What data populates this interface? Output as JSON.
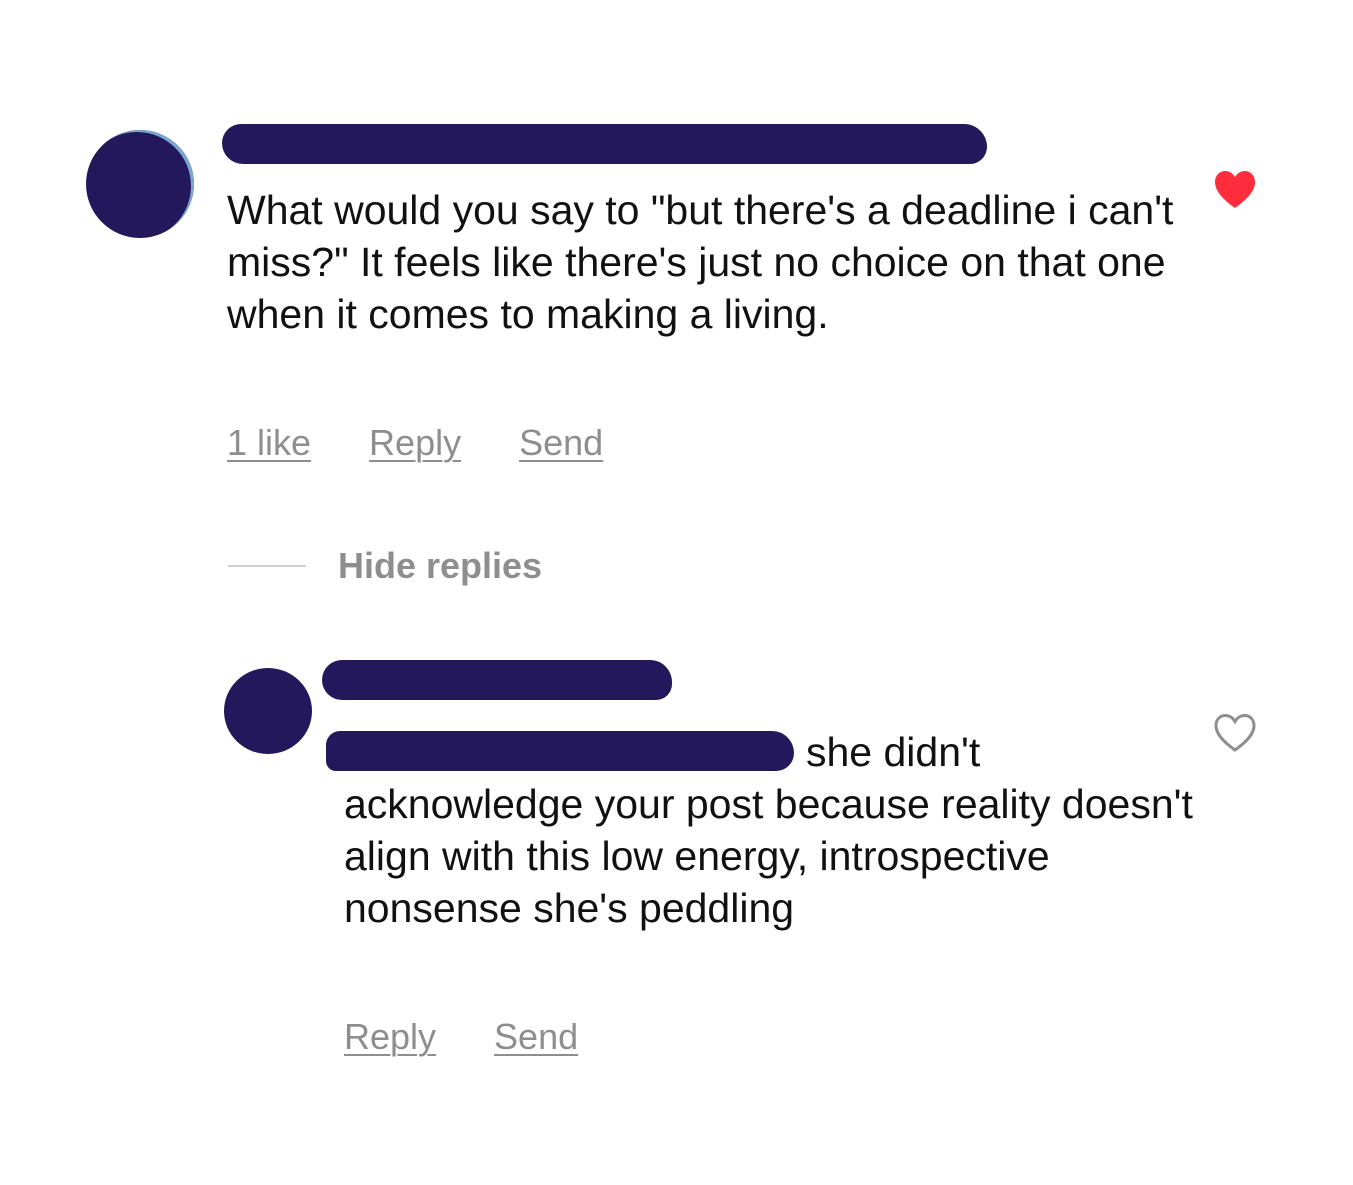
{
  "comment": {
    "text": "What would you say to \"but there's a deadline i can't miss?\" It feels like there's just no choice on that one when it comes to making a living.",
    "likes_label": "1 like",
    "reply_label": "Reply",
    "send_label": "Send",
    "liked": true
  },
  "thread": {
    "hide_replies_label": "Hide replies"
  },
  "reply": {
    "text_first": "she didn't",
    "text_rest": "acknowledge your post because reality doesn't align with this low energy, introspective nonsense she's peddling",
    "reply_label": "Reply",
    "send_label": "Send",
    "liked": false
  },
  "colors": {
    "redaction": "#24185c",
    "like_active": "#ff2d3c",
    "meta_text": "#8e8e8e"
  }
}
